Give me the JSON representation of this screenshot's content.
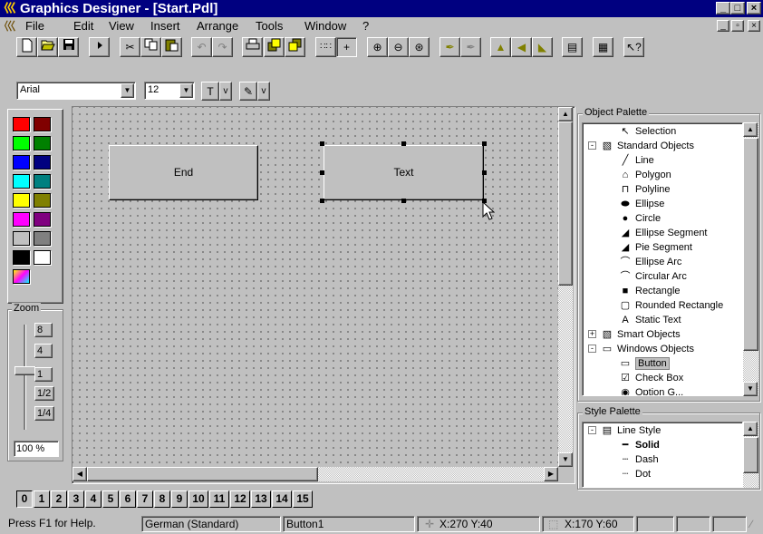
{
  "window": {
    "title": "Graphics Designer - [Start.Pdl]",
    "minimize": "_",
    "maximize": "□",
    "close": "×"
  },
  "menu": [
    "File",
    "Edit",
    "View",
    "Insert",
    "Arrange",
    "Tools",
    "Window",
    "?"
  ],
  "mdi_controls": [
    "_",
    "▫",
    "×"
  ],
  "toolbar_icons": [
    "new-icon",
    "open-icon",
    "save-icon",
    "run-icon",
    "cut-icon",
    "copy-icon",
    "paste-icon",
    "undo-icon",
    "redo-icon",
    "print-icon",
    "bring-front-icon",
    "send-back-icon",
    "grid-icon",
    "snap-icon",
    "zoom-in-icon",
    "zoom-out-icon",
    "zoom-fit-icon",
    "color-icon",
    "line-color-icon",
    "flip-horizontal-icon",
    "flip-vertical-icon",
    "rotate-icon",
    "properties-icon",
    "library-icon",
    "help-icon"
  ],
  "fontbar": {
    "font": "Arial",
    "size": "12",
    "text_color_arrow": "v",
    "line_color_arrow": "v"
  },
  "colors": [
    "#ff0000",
    "#800000",
    "#00ff00",
    "#008000",
    "#0000ff",
    "#000080",
    "#00ffff",
    "#008080",
    "#ffff00",
    "#808000",
    "#ff00ff",
    "#800080",
    "#c0c0c0",
    "#808080",
    "#000000",
    "#ffffff"
  ],
  "zoom": {
    "title": "Zoom",
    "levels": [
      "8",
      "4",
      "1",
      "1/2",
      "1/4"
    ],
    "current": "100 %",
    "level_value": "1"
  },
  "canvas": {
    "objects": [
      {
        "label": "End",
        "selected": false
      },
      {
        "label": "Text",
        "selected": true
      }
    ]
  },
  "object_palette": {
    "title": "Object Palette",
    "items": [
      {
        "label": "Selection",
        "icon": "arrow-cursor-icon",
        "level": 1
      },
      {
        "label": "Standard Objects",
        "icon": "standard-objects-icon",
        "level": 0,
        "expander": "-"
      },
      {
        "label": "Line",
        "icon": "line-icon",
        "level": 1
      },
      {
        "label": "Polygon",
        "icon": "polygon-icon",
        "level": 1
      },
      {
        "label": "Polyline",
        "icon": "polyline-icon",
        "level": 1
      },
      {
        "label": "Ellipse",
        "icon": "ellipse-icon",
        "level": 1
      },
      {
        "label": "Circle",
        "icon": "circle-icon",
        "level": 1
      },
      {
        "label": "Ellipse Segment",
        "icon": "ellipse-segment-icon",
        "level": 1
      },
      {
        "label": "Pie Segment",
        "icon": "pie-segment-icon",
        "level": 1
      },
      {
        "label": "Ellipse Arc",
        "icon": "ellipse-arc-icon",
        "level": 1
      },
      {
        "label": "Circular Arc",
        "icon": "circular-arc-icon",
        "level": 1
      },
      {
        "label": "Rectangle",
        "icon": "rectangle-icon",
        "level": 1
      },
      {
        "label": "Rounded Rectangle",
        "icon": "rounded-rectangle-icon",
        "level": 1
      },
      {
        "label": "Static Text",
        "icon": "static-text-icon",
        "level": 1
      },
      {
        "label": "Smart Objects",
        "icon": "smart-objects-icon",
        "level": 0,
        "expander": "+"
      },
      {
        "label": "Windows Objects",
        "icon": "windows-objects-icon",
        "level": 0,
        "expander": "-"
      },
      {
        "label": "Button",
        "icon": "button-icon",
        "level": 1,
        "highlighted": true
      },
      {
        "label": "Check Box",
        "icon": "check-box-icon",
        "level": 1
      },
      {
        "label": "Option G...",
        "icon": "option-group-icon",
        "level": 1
      }
    ]
  },
  "style_palette": {
    "title": "Style Palette",
    "items": [
      {
        "label": "Line Style",
        "icon": "line-style-icon",
        "level": 0,
        "expander": "-"
      },
      {
        "label": "Solid",
        "icon": "solid-line-icon",
        "level": 1,
        "bold": true
      },
      {
        "label": "Dash",
        "icon": "dash-line-icon",
        "level": 1
      },
      {
        "label": "Dot",
        "icon": "dot-line-icon",
        "level": 1
      }
    ]
  },
  "layers": [
    "0",
    "1",
    "2",
    "3",
    "4",
    "5",
    "6",
    "7",
    "8",
    "9",
    "10",
    "11",
    "12",
    "13",
    "14",
    "15"
  ],
  "statusbar": {
    "help": "Press F1 for Help.",
    "language": "German (Standard)",
    "object": "Button1",
    "position": "X:270 Y:40",
    "size": "X:170 Y:60"
  }
}
